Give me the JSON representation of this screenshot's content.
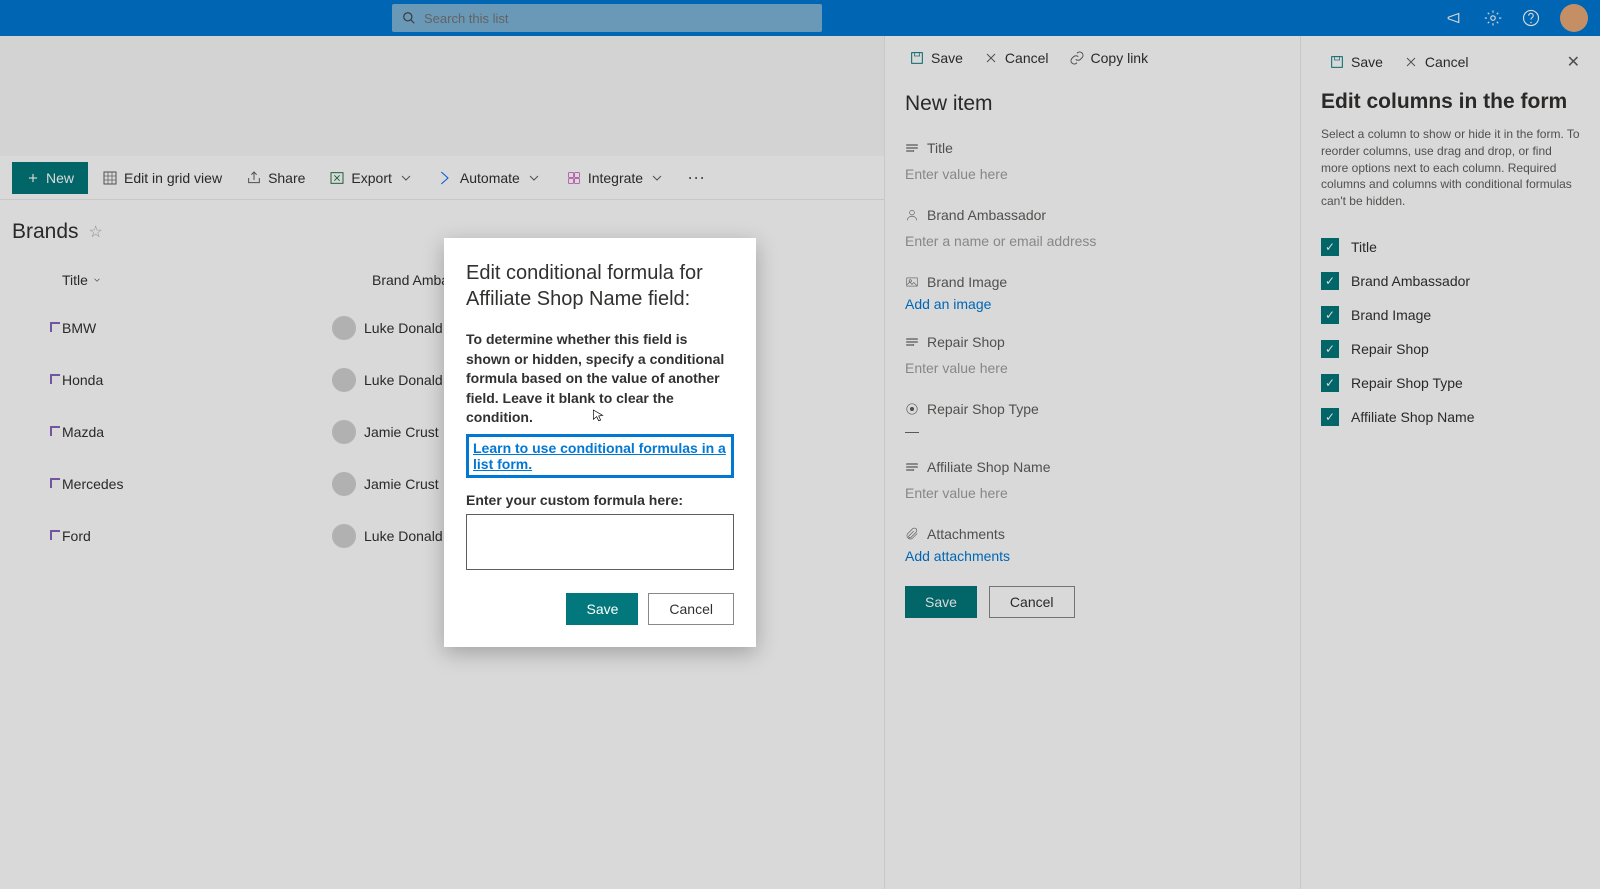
{
  "search": {
    "placeholder": "Search this list"
  },
  "cmdbar": {
    "new": "New",
    "grid": "Edit in grid view",
    "share": "Share",
    "export": "Export",
    "automate": "Automate",
    "integrate": "Integrate"
  },
  "list": {
    "title": "Brands",
    "columns": {
      "title": "Title",
      "ambassador": "Brand Ambassa..."
    },
    "rows": [
      {
        "title": "BMW",
        "person": "Luke Donald"
      },
      {
        "title": "Honda",
        "person": "Luke Donald"
      },
      {
        "title": "Mazda",
        "person": "Jamie Crust"
      },
      {
        "title": "Mercedes",
        "person": "Jamie Crust"
      },
      {
        "title": "Ford",
        "person": "Luke Donald"
      }
    ]
  },
  "formPanel": {
    "save": "Save",
    "cancel": "Cancel",
    "copylink": "Copy link",
    "title": "New item",
    "fields": {
      "title": {
        "label": "Title",
        "placeholder": "Enter value here"
      },
      "ambassador": {
        "label": "Brand Ambassador",
        "placeholder": "Enter a name or email address"
      },
      "image": {
        "label": "Brand Image",
        "action": "Add an image"
      },
      "shop": {
        "label": "Repair Shop",
        "placeholder": "Enter value here"
      },
      "shoptype": {
        "label": "Repair Shop Type",
        "value": "—"
      },
      "affiliate": {
        "label": "Affiliate Shop Name",
        "placeholder": "Enter value here"
      },
      "attachments": {
        "label": "Attachments",
        "action": "Add attachments"
      }
    },
    "saveBtn": "Save",
    "cancelBtn": "Cancel"
  },
  "editPanel": {
    "save": "Save",
    "cancel": "Cancel",
    "title": "Edit columns in the form",
    "desc": "Select a column to show or hide it in the form. To reorder columns, use drag and drop, or find more options next to each column. Required columns and columns with conditional formulas can't be hidden.",
    "cols": [
      "Title",
      "Brand Ambassador",
      "Brand Image",
      "Repair Shop",
      "Repair Shop Type",
      "Affiliate Shop Name"
    ]
  },
  "modal": {
    "title": "Edit conditional formula for Affiliate Shop Name field:",
    "desc": "To determine whether this field is shown or hidden, specify a conditional formula based on the value of another field. Leave it blank to clear the condition.",
    "link": "Learn to use conditional formulas in a list form.",
    "label": "Enter your custom formula here:",
    "save": "Save",
    "cancel": "Cancel"
  }
}
